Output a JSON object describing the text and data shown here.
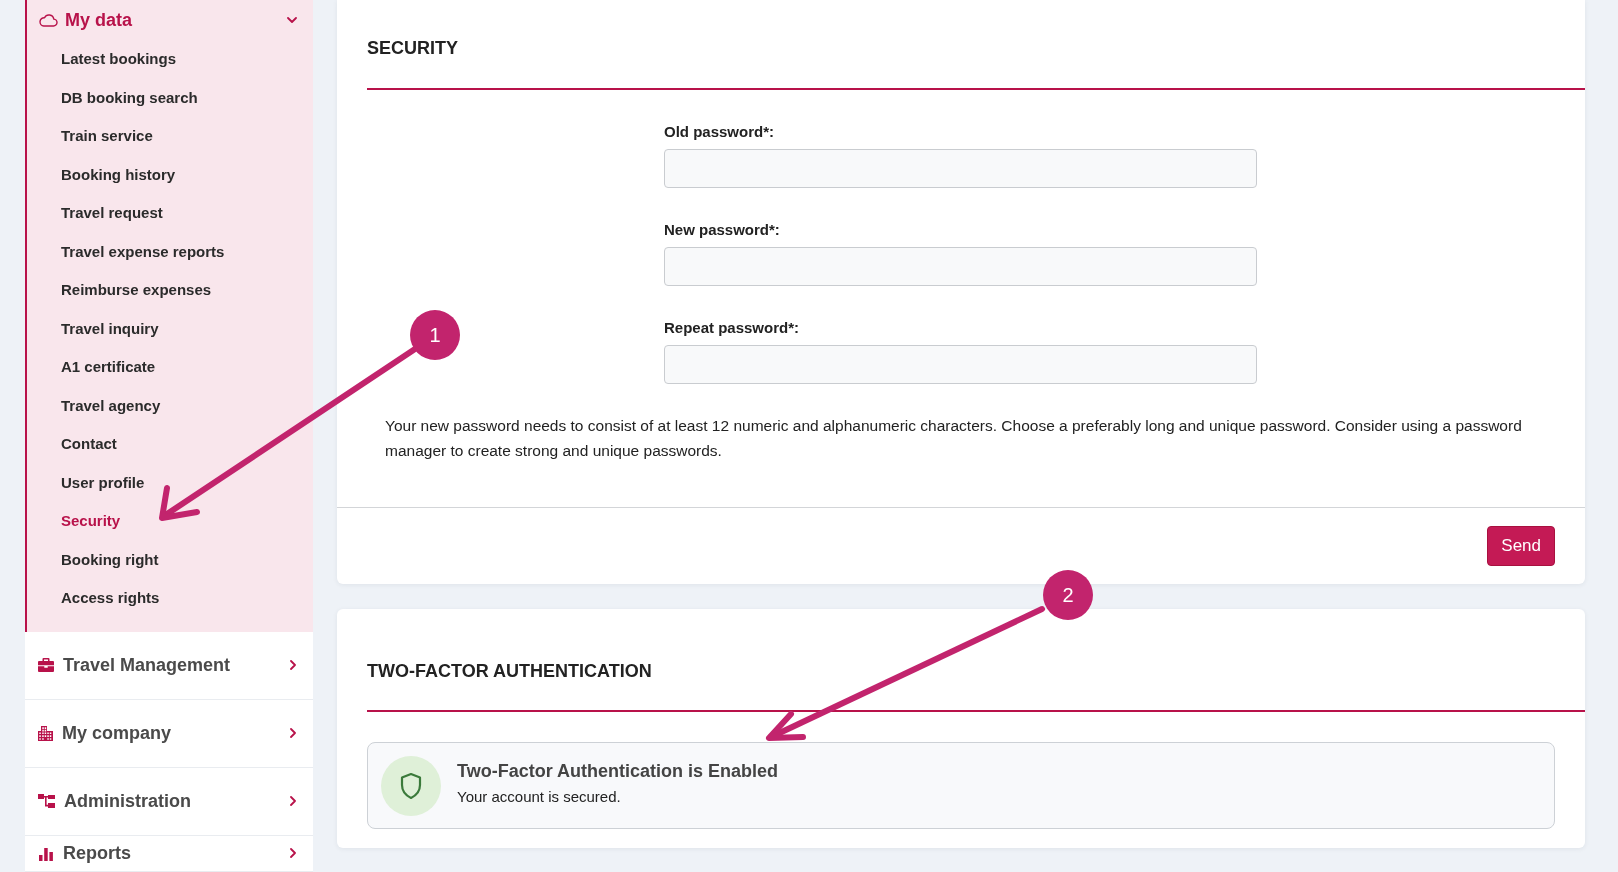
{
  "sidebar": {
    "groups": [
      {
        "label": "My data",
        "expanded": true,
        "children": [
          {
            "label": "Latest bookings",
            "selected": false
          },
          {
            "label": "DB booking search",
            "selected": false
          },
          {
            "label": "Train service",
            "selected": false
          },
          {
            "label": "Booking history",
            "selected": false
          },
          {
            "label": "Travel request",
            "selected": false
          },
          {
            "label": "Travel expense reports",
            "selected": false
          },
          {
            "label": "Reimburse expenses",
            "selected": false
          },
          {
            "label": "Travel inquiry",
            "selected": false
          },
          {
            "label": "A1 certificate",
            "selected": false
          },
          {
            "label": "Travel agency",
            "selected": false
          },
          {
            "label": "Contact",
            "selected": false
          },
          {
            "label": "User profile",
            "selected": false
          },
          {
            "label": "Security",
            "selected": true
          },
          {
            "label": "Booking right",
            "selected": false
          },
          {
            "label": "Access rights",
            "selected": false
          }
        ]
      },
      {
        "label": "Travel Management",
        "expanded": false
      },
      {
        "label": "My company",
        "expanded": false
      },
      {
        "label": "Administration",
        "expanded": false
      },
      {
        "label": "Reports",
        "expanded": false
      }
    ]
  },
  "security": {
    "title": "SECURITY",
    "fields": [
      {
        "label": "Old password*:"
      },
      {
        "label": "New password*:"
      },
      {
        "label": "Repeat password*:"
      }
    ],
    "hint": "Your new password needs to consist of at least 12 numeric and alphanumeric characters. Choose a preferably long and unique password. Consider using a password manager to create strong and unique passwords.",
    "submit": "Send"
  },
  "two_factor": {
    "title": "TWO-FACTOR AUTHENTICATION",
    "status": {
      "enabled": true,
      "title": "Two-Factor Authentication is Enabled",
      "message": "Your account is secured."
    }
  },
  "annotations": [
    {
      "label": "1"
    },
    {
      "label": "2"
    }
  ]
}
